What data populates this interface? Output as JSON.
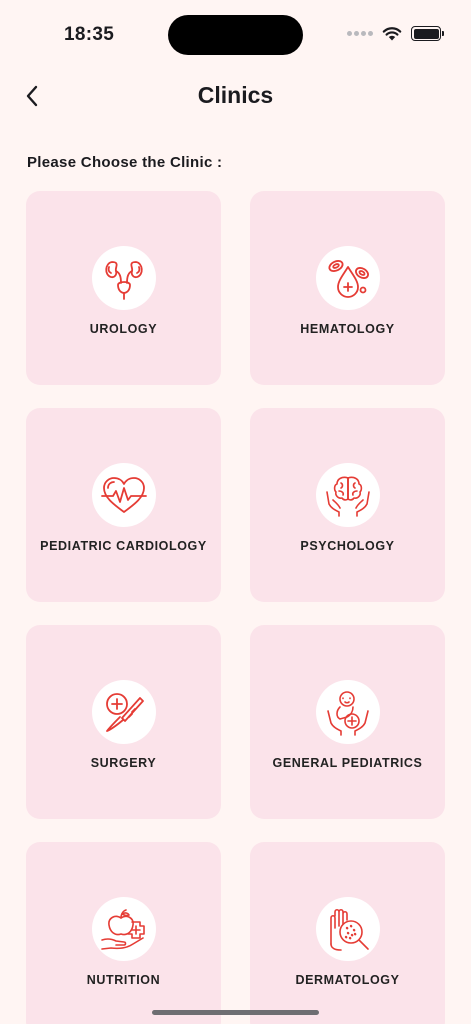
{
  "status": {
    "time": "18:35"
  },
  "nav": {
    "title": "Clinics"
  },
  "prompt": "Please Choose the Clinic :",
  "colors": {
    "background": "#fff5f3",
    "card": "#fbe3ea",
    "icon_stroke": "#e53c35"
  },
  "clinics": [
    {
      "label": "UROLOGY",
      "icon": "kidney-icon"
    },
    {
      "label": "HEMATOLOGY",
      "icon": "blood-drop-icon"
    },
    {
      "label": "PEDIATRIC CARDIOLOGY",
      "icon": "heartbeat-icon"
    },
    {
      "label": "PSYCHOLOGY",
      "icon": "brain-hands-icon"
    },
    {
      "label": "SURGERY",
      "icon": "scalpel-icon"
    },
    {
      "label": "GENERAL PEDIATRICS",
      "icon": "baby-care-icon"
    },
    {
      "label": "NUTRITION",
      "icon": "apple-hand-icon"
    },
    {
      "label": "DERMATOLOGY",
      "icon": "skin-magnifier-icon"
    }
  ]
}
